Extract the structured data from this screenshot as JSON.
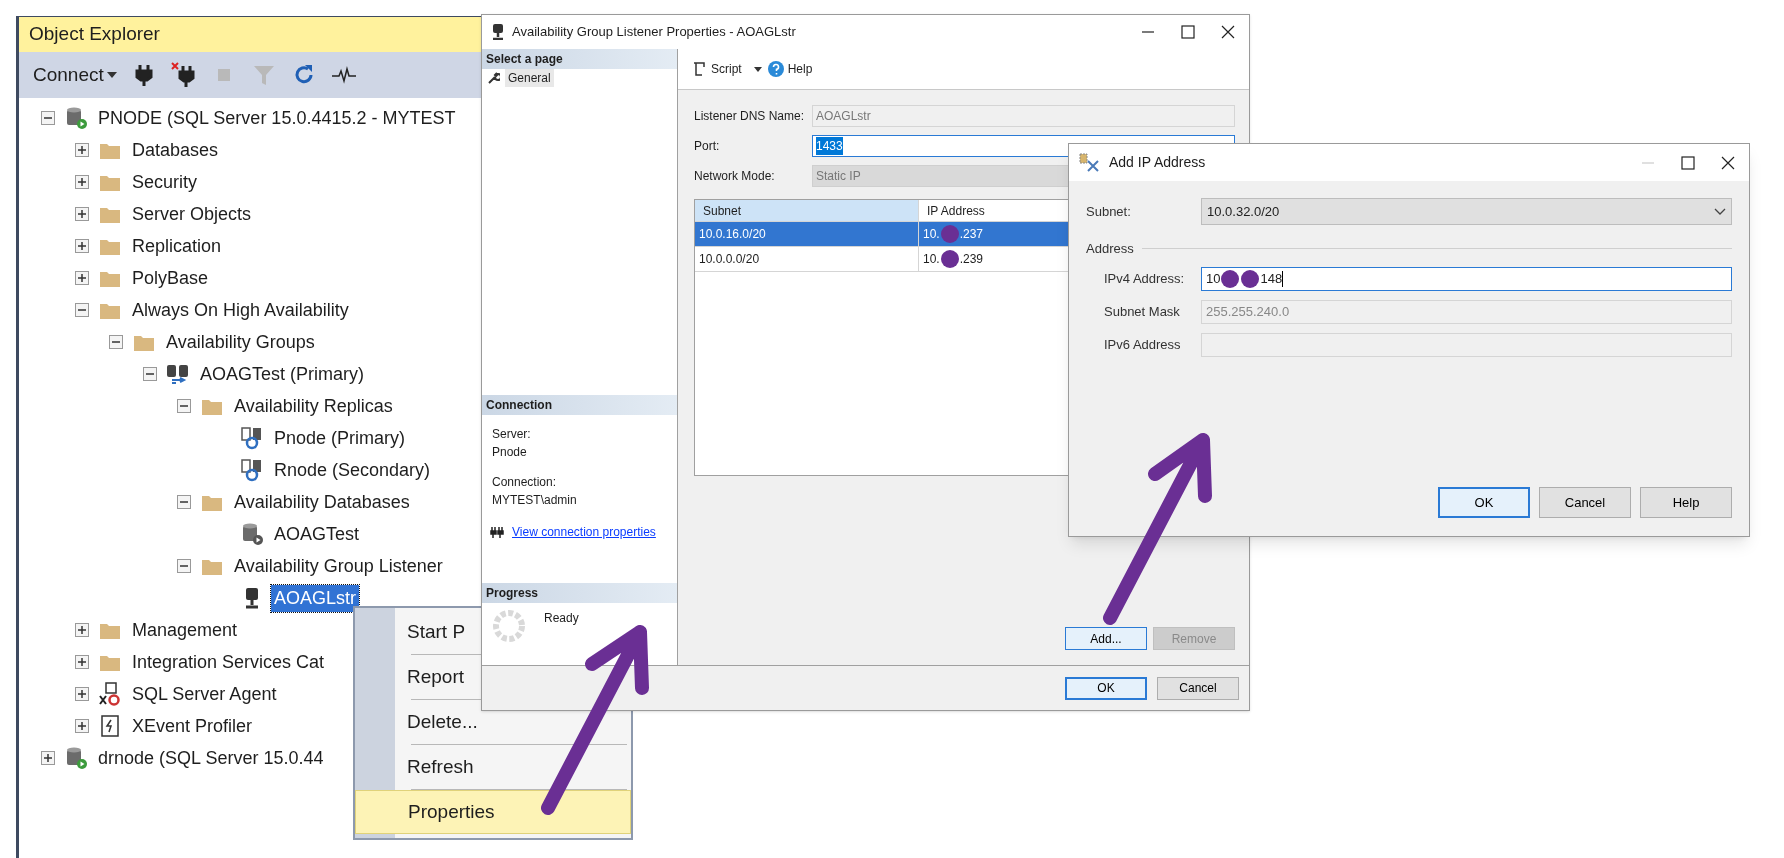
{
  "object_explorer": {
    "title": "Object Explorer",
    "connect": "Connect",
    "tools": [
      {
        "kind": "connect",
        "disabled": false
      },
      {
        "kind": "disconnect",
        "disabled": false
      },
      {
        "kind": "stop",
        "disabled": true
      },
      {
        "kind": "filter",
        "disabled": true
      },
      {
        "kind": "refresh",
        "disabled": false
      },
      {
        "kind": "activity",
        "disabled": false
      }
    ],
    "tree": [
      {
        "label": "PNODE (SQL Server 15.0.4415.2 - MYTEST",
        "kind": "server",
        "selected": false,
        "expanded": true,
        "children": [
          {
            "label": "Databases",
            "kind": "folder",
            "selected": false,
            "expanded": false
          },
          {
            "label": "Security",
            "kind": "folder",
            "selected": false,
            "expanded": false
          },
          {
            "label": "Server Objects",
            "kind": "folder",
            "selected": false,
            "expanded": false
          },
          {
            "label": "Replication",
            "kind": "folder",
            "selected": false,
            "expanded": false
          },
          {
            "label": "PolyBase",
            "kind": "folder",
            "selected": false,
            "expanded": false
          },
          {
            "label": "Always On High Availability",
            "kind": "folder",
            "selected": false,
            "expanded": true,
            "children": [
              {
                "label": "Availability Groups",
                "kind": "folder",
                "selected": false,
                "expanded": true,
                "children": [
                  {
                    "label": "AOAGTest (Primary)",
                    "kind": "ag",
                    "selected": false,
                    "expanded": true,
                    "children": [
                      {
                        "label": "Availability Replicas",
                        "kind": "folder",
                        "selected": false,
                        "expanded": true,
                        "children": [
                          {
                            "label": "Pnode (Primary)",
                            "kind": "replica",
                            "selected": false
                          },
                          {
                            "label": "Rnode (Secondary)",
                            "kind": "replica",
                            "selected": false
                          }
                        ]
                      },
                      {
                        "label": "Availability Databases",
                        "kind": "folder",
                        "selected": false,
                        "expanded": true,
                        "children": [
                          {
                            "label": "AOAGTest",
                            "kind": "database",
                            "selected": false
                          }
                        ]
                      },
                      {
                        "label": "Availability Group Listener",
                        "kind": "folder",
                        "selected": false,
                        "expanded": true,
                        "children": [
                          {
                            "label": "AOAGLstr",
                            "kind": "listener",
                            "selected": true
                          }
                        ]
                      }
                    ]
                  }
                ]
              }
            ]
          },
          {
            "label": "Management",
            "kind": "folder",
            "selected": false,
            "expanded": false
          },
          {
            "label": "Integration Services Cat",
            "kind": "folder",
            "selected": false,
            "expanded": false
          },
          {
            "label": "SQL Server Agent",
            "kind": "agent",
            "selected": false,
            "expanded": false
          },
          {
            "label": "XEvent Profiler",
            "kind": "xevent",
            "selected": false,
            "expanded": false
          }
        ]
      },
      {
        "label": "drnode (SQL Server 15.0.44",
        "kind": "server",
        "selected": false,
        "expanded": false
      }
    ]
  },
  "context_menu": {
    "items": [
      {
        "label": "Start P",
        "selected": false
      },
      {
        "label": "Report",
        "selected": false
      },
      {
        "label": "Delete...",
        "selected": false
      },
      {
        "label": "Refresh",
        "selected": false
      },
      {
        "label": "Properties",
        "selected": true
      }
    ]
  },
  "listener_dialog": {
    "title": "Availability Group Listener Properties - AOAGLstr",
    "select_page": {
      "header": "Select a page",
      "pages": [
        {
          "label": "General",
          "selected": true
        }
      ]
    },
    "connection": {
      "header": "Connection",
      "server_label": "Server:",
      "server": "Pnode",
      "connection_label": "Connection:",
      "connection": "MYTEST\\admin",
      "link": "View connection properties"
    },
    "progress": {
      "header": "Progress",
      "status": "Ready"
    },
    "toolbar": {
      "script": "Script",
      "help": "Help"
    },
    "fields": [
      {
        "label": "Listener DNS Name:",
        "value": "AOAGLstr",
        "kind": "readonly"
      },
      {
        "label": "Port:",
        "value": "1433",
        "kind": "focused"
      },
      {
        "label": "Network Mode:",
        "value": "Static IP",
        "kind": "disabled"
      }
    ],
    "table": {
      "columns": [
        "Subnet",
        "IP Address"
      ],
      "rows": [
        {
          "subnet": "10.0.16.0/20",
          "ip_start": "10.",
          "ip_end": ".237",
          "selected": true
        },
        {
          "subnet": "10.0.0.0/20",
          "ip_start": "10.",
          "ip_end": ".239",
          "selected": false
        }
      ]
    },
    "add": {
      "label": "Add...",
      "disabled": false
    },
    "remove": {
      "label": "Remove",
      "disabled": true
    },
    "ok": "OK",
    "cancel": "Cancel"
  },
  "add_ip_dialog": {
    "title": "Add IP Address",
    "subnet_label": "Subnet:",
    "subnet": "10.0.32.0/20",
    "group": "Address",
    "ipv4_label": "IPv4 Address:",
    "ipv4_start": "10",
    "ipv4_end": "148",
    "mask_label": "Subnet Mask",
    "mask": "255.255.240.0",
    "ipv6_label": "IPv6 Address",
    "buttons": [
      "OK",
      "Cancel",
      "Help"
    ]
  }
}
